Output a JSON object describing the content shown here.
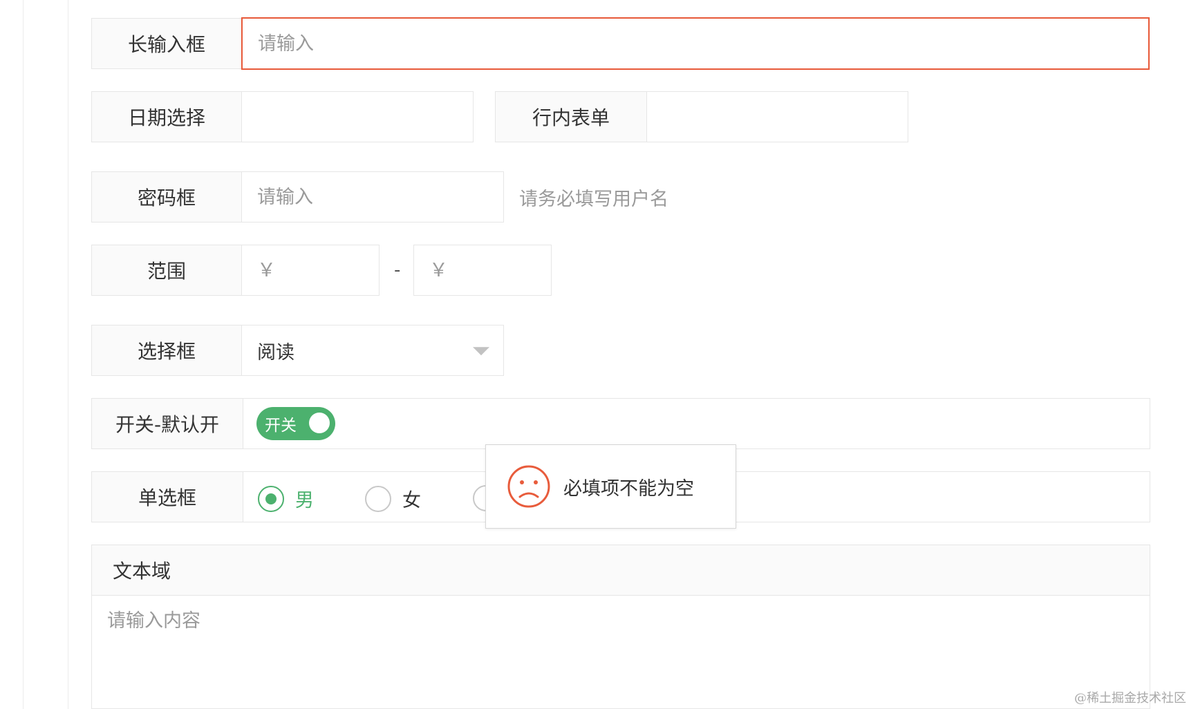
{
  "form": {
    "long_input": {
      "label": "长输入框",
      "placeholder": "请输入",
      "value": ""
    },
    "date": {
      "label": "日期选择",
      "value": ""
    },
    "inline": {
      "label": "行内表单",
      "value": ""
    },
    "password": {
      "label": "密码框",
      "placeholder": "请输入",
      "hint": "请务必填写用户名"
    },
    "range": {
      "label": "范围",
      "from_placeholder": "￥",
      "to_placeholder": "￥",
      "separator": "-"
    },
    "select": {
      "label": "选择框",
      "value": "阅读"
    },
    "switch": {
      "label": "开关-默认开",
      "text": "开关",
      "checked": true
    },
    "radio": {
      "label": "单选框",
      "options": [
        {
          "label": "男",
          "checked": true
        },
        {
          "label": "女",
          "checked": false
        }
      ]
    },
    "textarea": {
      "label": "文本域",
      "placeholder": "请输入内容"
    }
  },
  "toast": {
    "message": "必填项不能为空",
    "icon": "sad-face-icon",
    "color": "#e85c3c"
  },
  "colors": {
    "accent": "#4cb16e",
    "error": "#e85c3c"
  },
  "watermark": "@稀土掘金技术社区"
}
